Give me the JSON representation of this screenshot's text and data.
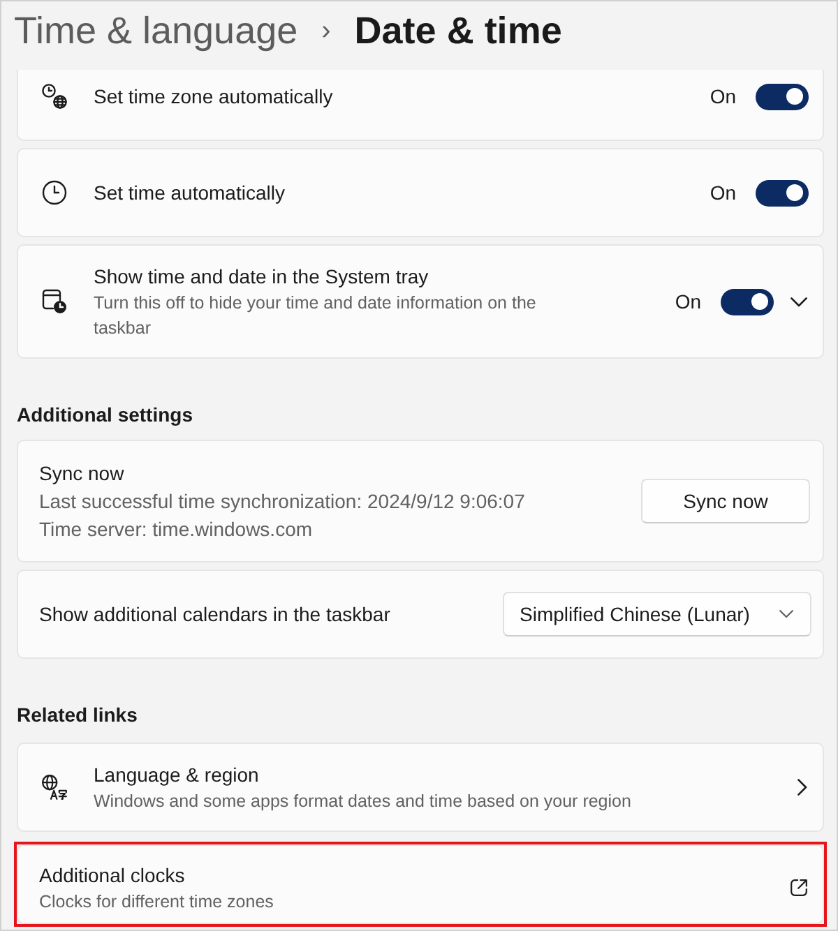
{
  "breadcrumb": {
    "parent": "Time & language",
    "separator": "›",
    "current": "Date & time"
  },
  "settings": [
    {
      "kind": "toggle",
      "title": "Set time zone automatically",
      "state_label": "On",
      "on": true
    },
    {
      "kind": "toggle",
      "title": "Set time automatically",
      "state_label": "On",
      "on": true
    },
    {
      "kind": "expandable-toggle",
      "title": "Show time and date in the System tray",
      "description": "Turn this off to hide your time and date information on the taskbar",
      "state_label": "On",
      "on": true,
      "expanded": false
    }
  ],
  "additional_settings": {
    "heading": "Additional settings",
    "items": [
      {
        "kind": "button",
        "title": "Sync now",
        "details": [
          "Last successful time synchronization: 2024/9/12 9:06:07",
          "Time server: time.windows.com"
        ],
        "button": "Sync now"
      },
      {
        "kind": "dropdown",
        "title": "Show additional calendars in the taskbar",
        "value": "Simplified Chinese (Lunar)"
      }
    ]
  },
  "related_links": {
    "heading": "Related links",
    "items": [
      {
        "kind": "internal",
        "title": "Language & region",
        "description": "Windows and some apps format dates and time based on your region",
        "highlighted": false
      },
      {
        "kind": "external",
        "title": "Additional clocks",
        "description": "Clocks for different time zones",
        "highlighted": true
      }
    ]
  }
}
